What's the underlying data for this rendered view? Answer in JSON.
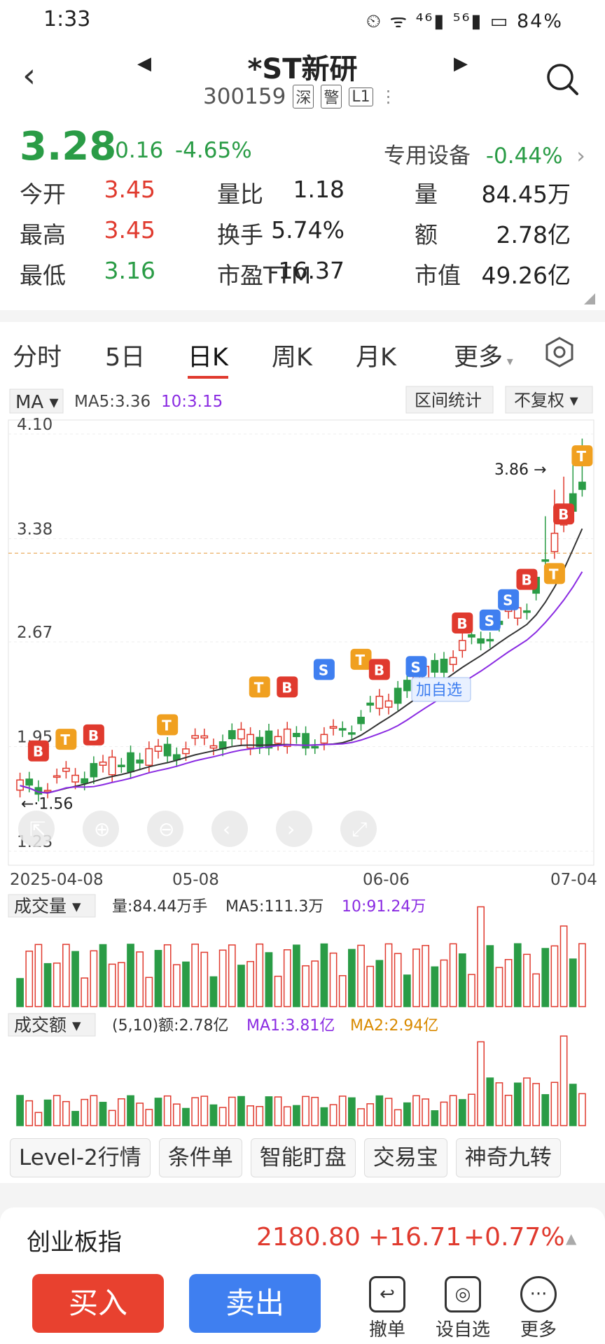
{
  "status_bar": {
    "time": "1:33",
    "icons": "⏲ ᯤ ⁴⁶▮ ⁵⁶▮ ▭",
    "battery": "84%"
  },
  "header": {
    "title": "*ST新研",
    "code": "300159",
    "tags": [
      "深",
      "警",
      "L1"
    ]
  },
  "quote": {
    "price": "3.28",
    "change": "-0.16",
    "change_pct": "-4.65%",
    "sector": "专用设备",
    "sector_pct": "-0.44%",
    "stats": [
      [
        {
          "k": "今开",
          "v": "3.45",
          "c": "red"
        },
        {
          "k": "量比",
          "v": "1.18",
          "c": "dark"
        },
        {
          "k": "量",
          "v": "84.45万",
          "c": "dark"
        }
      ],
      [
        {
          "k": "最高",
          "v": "3.45",
          "c": "red"
        },
        {
          "k": "换手",
          "v": "5.74%",
          "c": "dark"
        },
        {
          "k": "额",
          "v": "2.78亿",
          "c": "dark"
        }
      ],
      [
        {
          "k": "最低",
          "v": "3.16",
          "c": "green"
        },
        {
          "k": "市盈TTM",
          "v": "-16.37",
          "c": "dark"
        },
        {
          "k": "市值",
          "v": "49.26亿",
          "c": "dark"
        }
      ]
    ]
  },
  "tabs": {
    "items": [
      "分时",
      "5日",
      "日K",
      "周K",
      "月K",
      "更多"
    ],
    "active": "日K"
  },
  "chart_toolbar": {
    "ma_select": "MA",
    "ma5": "MA5:3.36",
    "ma10": "10:3.15",
    "range_stats": "区间统计",
    "adjust": "不复权"
  },
  "chart_data": {
    "type": "candlestick",
    "y_ticks": [
      "4.10",
      "3.38",
      "2.67",
      "1.95",
      "1.23"
    ],
    "x_ticks": [
      "2025-04-08",
      "05-08",
      "06-06",
      "07-04"
    ],
    "ylim": [
      1.23,
      4.1
    ],
    "high_label": "3.86",
    "low_label": "1.56",
    "add_watchlist": "加自选"
  },
  "volume": {
    "label": "成交量",
    "text": "量:84.44万手",
    "ma5": "MA5:111.3万",
    "ma10": "10:91.24万"
  },
  "amount": {
    "label": "成交额",
    "text": "(5,10)额:2.78亿",
    "ma1": "MA1:3.81亿",
    "ma2": "MA2:2.94亿"
  },
  "shortcuts": [
    "Level-2行情",
    "条件单",
    "智能盯盘",
    "交易宝",
    "神奇九转"
  ],
  "index_bar": {
    "name": "创业板指",
    "value": "2180.80",
    "change": "+16.71",
    "pct": "+0.77%"
  },
  "actions": {
    "buy": "买入",
    "sell": "卖出",
    "cancel": "撤单",
    "watch": "设自选",
    "more": "更多"
  },
  "colors": {
    "up": "#e03a2e",
    "down": "#2a9c46",
    "buy": "#e8412f",
    "sell": "#3f7ff0",
    "ma10": "#8a2be2",
    "ma5": "#333333"
  }
}
